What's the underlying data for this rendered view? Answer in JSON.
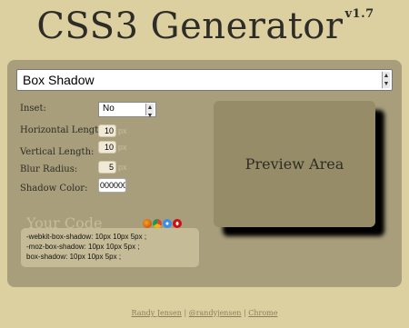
{
  "header": {
    "title": "CSS3 Generator",
    "version": "v1.7"
  },
  "generator": {
    "selected": "Box Shadow"
  },
  "form": {
    "inset": {
      "label": "Inset:",
      "value": "No"
    },
    "horizontal": {
      "label": "Horizontal Length:",
      "value": "10",
      "unit": "px"
    },
    "vertical": {
      "label": "Vertical Length:",
      "value": "10",
      "unit": "px"
    },
    "blur": {
      "label": "Blur Radius:",
      "value": "5",
      "unit": "px"
    },
    "color": {
      "label": "Shadow Color:",
      "value": "000000"
    }
  },
  "preview": {
    "label": "Preview Area"
  },
  "code": {
    "heading": "Your Code",
    "lines": [
      "-webkit-box-shadow: 10px 10px 5px ;",
      "-moz-box-shadow: 10px 10px 5px ;",
      "box-shadow: 10px 10px 5px ;"
    ]
  },
  "browsers": [
    "firefox-icon",
    "chrome-icon",
    "safari-icon",
    "opera-icon"
  ],
  "footer": {
    "author": "Randy Jensen",
    "sep1": " | ",
    "twitter": "@randyjensen",
    "sep2": " | ",
    "browser": "Chrome"
  },
  "colors": {
    "background": "#dcd0a0",
    "panel": "#a89e7c",
    "preview": "#968d68",
    "code_box": "#c5bb97"
  }
}
